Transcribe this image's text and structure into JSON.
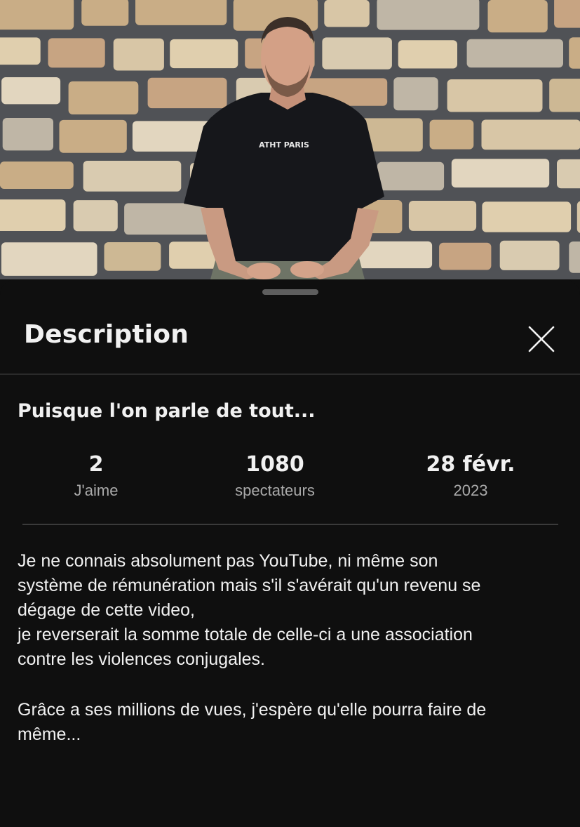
{
  "video": {
    "shirt_text": "ATHT PARIS"
  },
  "sheet": {
    "title": "Description",
    "close_icon": "close-icon"
  },
  "video_title": "Puisque l'on parle de tout...",
  "stats": {
    "likes_value": "2",
    "likes_label": "J'aime",
    "viewers_value": "1080",
    "viewers_label": "spectateurs",
    "date_value": "28 févr.",
    "date_year": "2023"
  },
  "description": {
    "paragraph_1": [
      "Je ne connais absolument pas YouTube, ni même son",
      "système de rémunération mais s'il s'avérait qu'un revenu se",
      "dégage de cette video,",
      "je reverserait la somme totale de celle-ci a une association",
      "contre les violences conjugales."
    ],
    "paragraph_2": [
      "Grâce a ses millions de vues, j'espère qu'elle pourra faire de",
      "même..."
    ]
  },
  "colors": {
    "background": "#0f0f0f",
    "text_primary": "#f1f1f1",
    "text_secondary": "#aaaaaa",
    "handle": "#5e5e5e"
  }
}
